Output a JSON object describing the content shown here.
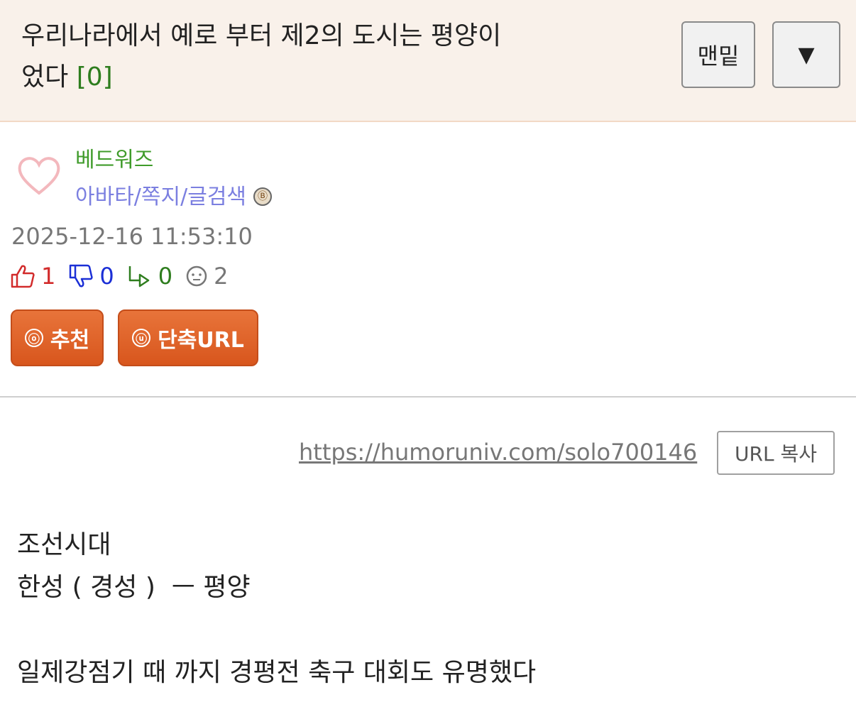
{
  "header": {
    "title_line1": "우리나라에서 예로 부터 제2의 도시는 평양이",
    "title_line2": "었다",
    "comment_count": "[0]",
    "bottom_button_label": "맨밑",
    "dropdown_button_label": "▼"
  },
  "author": {
    "name": "베드워즈",
    "links": "아바타/쪽지/글검색",
    "level_badge_glyph": "Ⓑ",
    "datetime": "2025-12-16 11:53:10"
  },
  "stats": {
    "upvotes": "1",
    "downvotes": "0",
    "replies": "0",
    "views": "2"
  },
  "actions": {
    "recommend_icon": "ⓞ",
    "recommend_label": "추천",
    "shorturl_icon": "ⓤ",
    "shorturl_label": "단축URL"
  },
  "url": {
    "link": "https://humoruniv.com/solo700146",
    "copy_label": "URL 복사"
  },
  "content": {
    "lines": [
      "조선시대",
      "한성 ( 경성 )  ㅡ 평양",
      "",
      "일제강점기 때 까지 경평전 축구 대회도 유명했다"
    ]
  },
  "colors": {
    "header_bg": "#f9f1ea",
    "author_green": "#3f9b2a",
    "link_purple": "#7b7fe0",
    "upvote_red": "#d22b2b",
    "downvote_blue": "#1b2fd6",
    "reply_green": "#2e7d1e",
    "orange_button": "#e0652a"
  },
  "icons": {
    "avatar": "heart-outline-icon",
    "up": "thumbs-up-icon",
    "down": "thumbs-down-icon",
    "reply": "reply-arrow-icon",
    "view": "face-icon"
  }
}
